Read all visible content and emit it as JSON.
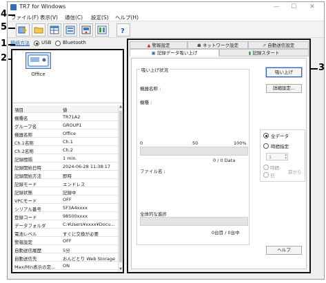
{
  "window": {
    "title": "TR7 for Windows",
    "minimize": "—",
    "maximize": "☐",
    "close": "✕"
  },
  "menu": [
    "ファイル(F)",
    "表示(V)",
    "通信(C)",
    "設定(S)",
    "ヘルプ(H)"
  ],
  "toolbar": {
    "buttons": [
      "read-data-icon",
      "open-folder-icon",
      "table-view-icon",
      "device-list-icon",
      "logger-settings-icon",
      "record-start-icon",
      "help-icon"
    ],
    "help_glyph": "?"
  },
  "connection": {
    "label": "接続方法",
    "options": [
      "USB",
      "Bluetooth"
    ],
    "selected": "USB"
  },
  "device": {
    "name": "Office"
  },
  "properties": [
    [
      "項目",
      "値"
    ],
    [
      "機種名",
      "TR71A2"
    ],
    [
      "グループ名",
      "GROUP1"
    ],
    [
      "機器名称",
      "Office"
    ],
    [
      "Ch.1名称",
      "Ch.1"
    ],
    [
      "Ch.2名称",
      "Ch.2"
    ],
    [
      "記録間隔",
      "1 min."
    ],
    [
      "記録開始日時",
      "2024-06-28 11:38:17"
    ],
    [
      "記録開始方法",
      "即時"
    ],
    [
      "記録モード",
      "エンドレス"
    ],
    [
      "記録状態",
      "記録中"
    ],
    [
      "VPCモード",
      "OFF"
    ],
    [
      "シリアル番号",
      "5F3A4xxxx"
    ],
    [
      "登録コード",
      "98500xxxx"
    ],
    [
      "データフォルダ",
      "C:¥Users¥xxxx¥Docu..."
    ],
    [
      "電池レベル",
      "すぐに交換が必要"
    ],
    [
      "警報設定",
      "OFF"
    ],
    [
      "自動送信履歴",
      "5分"
    ],
    [
      "自動送信先",
      "おんどとり Web Storage"
    ],
    [
      "Max/Min表示の定...",
      "ON"
    ]
  ],
  "tabs": {
    "row1": [
      "警報設定",
      "ネットワーク設定",
      "自動送信設定"
    ],
    "row2": [
      "記録データ吸い上げ",
      "記録スタート"
    ],
    "active": "記録データ吸い上げ"
  },
  "readout": {
    "group_title": "吸い上げ状況",
    "device_name_label": "機器名称 :",
    "model_label": "機種 :",
    "scale": [
      "0",
      "50",
      "100%"
    ],
    "progress_pct": 0,
    "data_count": "0 / 0 Data",
    "file_label": "ファイル名 :",
    "overall_label": "全体的な進捗",
    "overall_pct": 0,
    "overall_count": "0台目 / 0台中"
  },
  "buttons": {
    "read": "吸い上げ",
    "details": "詳細設定...",
    "help": "ヘルプ"
  },
  "range": {
    "options": [
      "全データ",
      "時間指定"
    ],
    "selected": "全データ",
    "spin_value": "1",
    "units": [
      "時間",
      "日"
    ],
    "suffix": "前から"
  },
  "callouts": [
    "1",
    "2",
    "3",
    "4",
    "5"
  ]
}
